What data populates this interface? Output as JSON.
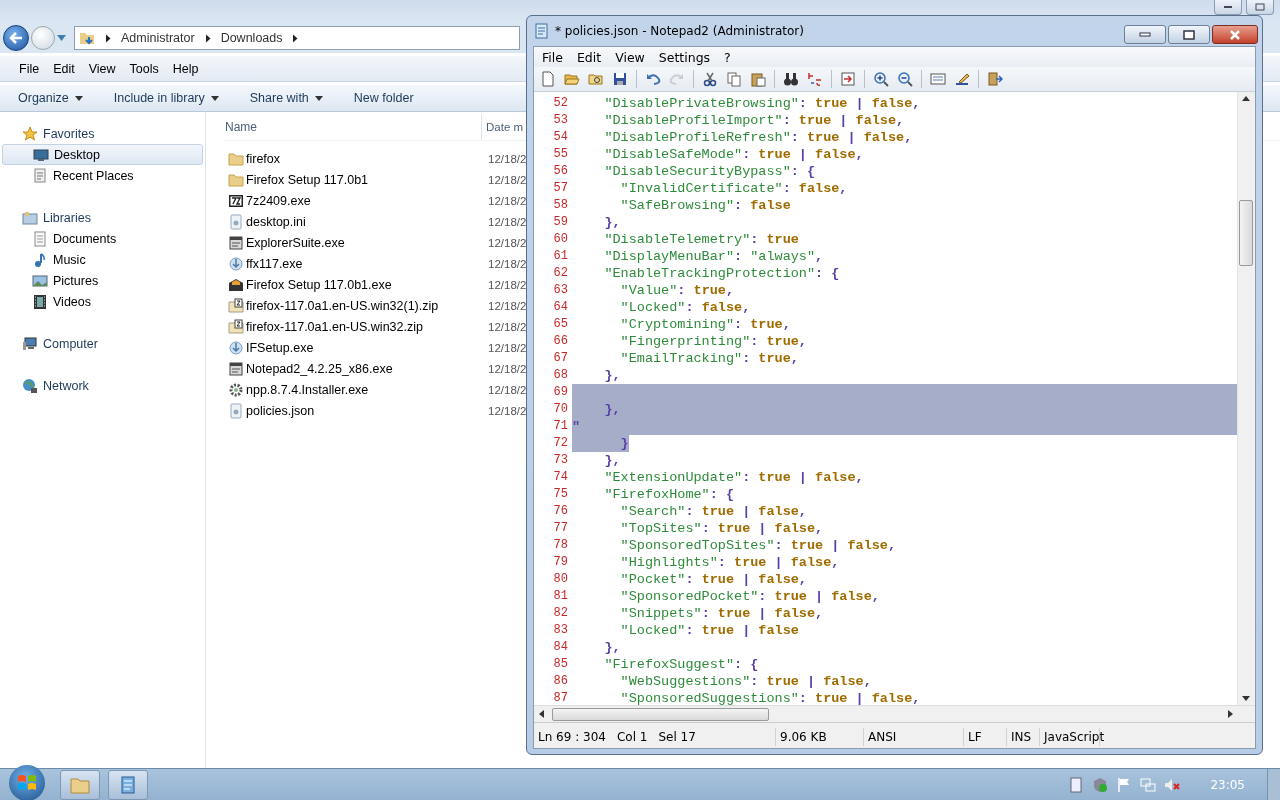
{
  "explorer": {
    "address": [
      "Administrator",
      "Downloads"
    ],
    "menu": [
      "File",
      "Edit",
      "View",
      "Tools",
      "Help"
    ],
    "commands": [
      {
        "label": "Organize",
        "dropdown": true
      },
      {
        "label": "Include in library",
        "dropdown": true
      },
      {
        "label": "Share with",
        "dropdown": true
      },
      {
        "label": "New folder",
        "dropdown": false
      }
    ],
    "nav": [
      {
        "label": "Favorites",
        "kind": "star",
        "selected": false,
        "children": [
          {
            "label": "Desktop",
            "kind": "desktop",
            "selected": true
          },
          {
            "label": "Recent Places",
            "kind": "recent",
            "selected": false
          }
        ]
      },
      {
        "label": "Libraries",
        "kind": "library",
        "selected": false,
        "children": [
          {
            "label": "Documents",
            "kind": "document",
            "selected": false
          },
          {
            "label": "Music",
            "kind": "music",
            "selected": false
          },
          {
            "label": "Pictures",
            "kind": "pictures",
            "selected": false
          },
          {
            "label": "Videos",
            "kind": "video",
            "selected": false
          }
        ]
      },
      {
        "label": "Computer",
        "kind": "computer",
        "selected": false
      },
      {
        "label": "Network",
        "kind": "network",
        "selected": false
      }
    ],
    "columns": [
      "Name",
      "Date m"
    ],
    "files": [
      {
        "name": "firefox",
        "date": "12/18/2",
        "kind": "folder"
      },
      {
        "name": "Firefox Setup 117.0b1",
        "date": "12/18/2",
        "kind": "folder"
      },
      {
        "name": "7z2409.exe",
        "date": "12/18/2",
        "kind": "sevenzip"
      },
      {
        "name": "desktop.ini",
        "date": "12/18/2",
        "kind": "settings"
      },
      {
        "name": "ExplorerSuite.exe",
        "date": "12/18/2",
        "kind": "app"
      },
      {
        "name": "ffx117.exe",
        "date": "12/18/2",
        "kind": "installer"
      },
      {
        "name": "Firefox Setup 117.0b1.exe",
        "date": "12/18/2",
        "kind": "package"
      },
      {
        "name": "firefox-117.0a1.en-US.win32(1).zip",
        "date": "12/18/2",
        "kind": "zip"
      },
      {
        "name": "firefox-117.0a1.en-US.win32.zip",
        "date": "12/18/2",
        "kind": "zip"
      },
      {
        "name": "IFSetup.exe",
        "date": "12/18/2",
        "kind": "installer"
      },
      {
        "name": "Notepad2_4.2.25_x86.exe",
        "date": "12/18/2",
        "kind": "app"
      },
      {
        "name": "npp.8.7.4.Installer.exe",
        "date": "12/18/2",
        "kind": "gear"
      },
      {
        "name": "policies.json",
        "date": "12/18/2",
        "kind": "settings"
      }
    ]
  },
  "notepad": {
    "title": "* policies.json - Notepad2 (Administrator)",
    "menu": [
      "File",
      "Edit",
      "View",
      "Settings",
      "?"
    ],
    "lines": [
      {
        "n": "52",
        "selected": false,
        "tokens": [
          {
            "kind": "key",
            "text": "    \"DisablePrivateBrowsing\""
          },
          {
            "kind": "punct",
            "text": ": "
          },
          {
            "kind": "bool",
            "text": "true"
          },
          {
            "kind": "punct",
            "text": " | "
          },
          {
            "kind": "bool",
            "text": "false"
          },
          {
            "kind": "punct",
            "text": ","
          }
        ]
      },
      {
        "n": "53",
        "selected": false,
        "tokens": [
          {
            "kind": "key",
            "text": "    \"DisableProfileImport\""
          },
          {
            "kind": "punct",
            "text": ": "
          },
          {
            "kind": "bool",
            "text": "true"
          },
          {
            "kind": "punct",
            "text": " | "
          },
          {
            "kind": "bool",
            "text": "false"
          },
          {
            "kind": "punct",
            "text": ","
          }
        ]
      },
      {
        "n": "54",
        "selected": false,
        "tokens": [
          {
            "kind": "key",
            "text": "    \"DisableProfileRefresh\""
          },
          {
            "kind": "punct",
            "text": ": "
          },
          {
            "kind": "bool",
            "text": "true"
          },
          {
            "kind": "punct",
            "text": " | "
          },
          {
            "kind": "bool",
            "text": "false"
          },
          {
            "kind": "punct",
            "text": ","
          }
        ]
      },
      {
        "n": "55",
        "selected": false,
        "tokens": [
          {
            "kind": "key",
            "text": "    \"DisableSafeMode\""
          },
          {
            "kind": "punct",
            "text": ": "
          },
          {
            "kind": "bool",
            "text": "true"
          },
          {
            "kind": "punct",
            "text": " | "
          },
          {
            "kind": "bool",
            "text": "false"
          },
          {
            "kind": "punct",
            "text": ","
          }
        ]
      },
      {
        "n": "56",
        "selected": false,
        "tokens": [
          {
            "kind": "key",
            "text": "    \"DisableSecurityBypass\""
          },
          {
            "kind": "punct",
            "text": ": {"
          }
        ]
      },
      {
        "n": "57",
        "selected": false,
        "tokens": [
          {
            "kind": "key",
            "text": "      \"InvalidCertificate\""
          },
          {
            "kind": "punct",
            "text": ": "
          },
          {
            "kind": "bool",
            "text": "false"
          },
          {
            "kind": "punct",
            "text": ","
          }
        ]
      },
      {
        "n": "58",
        "selected": false,
        "tokens": [
          {
            "kind": "key",
            "text": "      \"SafeBrowsing\""
          },
          {
            "kind": "punct",
            "text": ": "
          },
          {
            "kind": "bool",
            "text": "false"
          }
        ]
      },
      {
        "n": "59",
        "selected": false,
        "tokens": [
          {
            "kind": "punct",
            "text": "    },"
          }
        ]
      },
      {
        "n": "60",
        "selected": false,
        "tokens": [
          {
            "kind": "key",
            "text": "    \"DisableTelemetry\""
          },
          {
            "kind": "punct",
            "text": ": "
          },
          {
            "kind": "bool",
            "text": "true"
          }
        ]
      },
      {
        "n": "61",
        "selected": false,
        "tokens": [
          {
            "kind": "key",
            "text": "    \"DisplayMenuBar\""
          },
          {
            "kind": "punct",
            "text": ": "
          },
          {
            "kind": "str",
            "text": "\"always\""
          },
          {
            "kind": "punct",
            "text": ","
          }
        ]
      },
      {
        "n": "62",
        "selected": false,
        "tokens": [
          {
            "kind": "key",
            "text": "    \"EnableTrackingProtection\""
          },
          {
            "kind": "punct",
            "text": ": {"
          }
        ]
      },
      {
        "n": "63",
        "selected": false,
        "tokens": [
          {
            "kind": "key",
            "text": "      \"Value\""
          },
          {
            "kind": "punct",
            "text": ": "
          },
          {
            "kind": "bool",
            "text": "true"
          },
          {
            "kind": "punct",
            "text": ","
          }
        ]
      },
      {
        "n": "64",
        "selected": false,
        "tokens": [
          {
            "kind": "key",
            "text": "      \"Locked\""
          },
          {
            "kind": "punct",
            "text": ": "
          },
          {
            "kind": "bool",
            "text": "false"
          },
          {
            "kind": "punct",
            "text": ","
          }
        ]
      },
      {
        "n": "65",
        "selected": false,
        "tokens": [
          {
            "kind": "key",
            "text": "      \"Cryptomining\""
          },
          {
            "kind": "punct",
            "text": ": "
          },
          {
            "kind": "bool",
            "text": "true"
          },
          {
            "kind": "punct",
            "text": ","
          }
        ]
      },
      {
        "n": "66",
        "selected": false,
        "tokens": [
          {
            "kind": "key",
            "text": "      \"Fingerprinting\""
          },
          {
            "kind": "punct",
            "text": ": "
          },
          {
            "kind": "bool",
            "text": "true"
          },
          {
            "kind": "punct",
            "text": ","
          }
        ]
      },
      {
        "n": "67",
        "selected": false,
        "tokens": [
          {
            "kind": "key",
            "text": "      \"EmailTracking\""
          },
          {
            "kind": "punct",
            "text": ": "
          },
          {
            "kind": "bool",
            "text": "true"
          },
          {
            "kind": "punct",
            "text": ","
          }
        ]
      },
      {
        "n": "68",
        "selected": false,
        "tokens": [
          {
            "kind": "punct",
            "text": "    },"
          }
        ]
      },
      {
        "n": "69",
        "selected": true
      },
      {
        "n": "70",
        "selected": true,
        "tokens": [
          {
            "kind": "punct",
            "text": "    },"
          }
        ]
      },
      {
        "n": "71",
        "selected": true,
        "tokens": [
          {
            "kind": "punct",
            "text": "\""
          }
        ]
      },
      {
        "n": "72",
        "selected": true,
        "partial": true,
        "tokens": [
          {
            "kind": "punct",
            "text": "      }"
          }
        ]
      },
      {
        "n": "73",
        "selected": false,
        "tokens": [
          {
            "kind": "punct",
            "text": "    },"
          }
        ]
      },
      {
        "n": "74",
        "selected": false,
        "tokens": [
          {
            "kind": "key",
            "text": "    \"ExtensionUpdate\""
          },
          {
            "kind": "punct",
            "text": ": "
          },
          {
            "kind": "bool",
            "text": "true"
          },
          {
            "kind": "punct",
            "text": " | "
          },
          {
            "kind": "bool",
            "text": "false"
          },
          {
            "kind": "punct",
            "text": ","
          }
        ]
      },
      {
        "n": "75",
        "selected": false,
        "tokens": [
          {
            "kind": "key",
            "text": "    \"FirefoxHome\""
          },
          {
            "kind": "punct",
            "text": ": {"
          }
        ]
      },
      {
        "n": "76",
        "selected": false,
        "tokens": [
          {
            "kind": "key",
            "text": "      \"Search\""
          },
          {
            "kind": "punct",
            "text": ": "
          },
          {
            "kind": "bool",
            "text": "true"
          },
          {
            "kind": "punct",
            "text": " | "
          },
          {
            "kind": "bool",
            "text": "false"
          },
          {
            "kind": "punct",
            "text": ","
          }
        ]
      },
      {
        "n": "77",
        "selected": false,
        "tokens": [
          {
            "kind": "key",
            "text": "      \"TopSites\""
          },
          {
            "kind": "punct",
            "text": ": "
          },
          {
            "kind": "bool",
            "text": "true"
          },
          {
            "kind": "punct",
            "text": " | "
          },
          {
            "kind": "bool",
            "text": "false"
          },
          {
            "kind": "punct",
            "text": ","
          }
        ]
      },
      {
        "n": "78",
        "selected": false,
        "tokens": [
          {
            "kind": "key",
            "text": "      \"SponsoredTopSites\""
          },
          {
            "kind": "punct",
            "text": ": "
          },
          {
            "kind": "bool",
            "text": "true"
          },
          {
            "kind": "punct",
            "text": " | "
          },
          {
            "kind": "bool",
            "text": "false"
          },
          {
            "kind": "punct",
            "text": ","
          }
        ]
      },
      {
        "n": "79",
        "selected": false,
        "tokens": [
          {
            "kind": "key",
            "text": "      \"Highlights\""
          },
          {
            "kind": "punct",
            "text": ": "
          },
          {
            "kind": "bool",
            "text": "true"
          },
          {
            "kind": "punct",
            "text": " | "
          },
          {
            "kind": "bool",
            "text": "false"
          },
          {
            "kind": "punct",
            "text": ","
          }
        ]
      },
      {
        "n": "80",
        "selected": false,
        "tokens": [
          {
            "kind": "key",
            "text": "      \"Pocket\""
          },
          {
            "kind": "punct",
            "text": ": "
          },
          {
            "kind": "bool",
            "text": "true"
          },
          {
            "kind": "punct",
            "text": " | "
          },
          {
            "kind": "bool",
            "text": "false"
          },
          {
            "kind": "punct",
            "text": ","
          }
        ]
      },
      {
        "n": "81",
        "selected": false,
        "tokens": [
          {
            "kind": "key",
            "text": "      \"SponsoredPocket\""
          },
          {
            "kind": "punct",
            "text": ": "
          },
          {
            "kind": "bool",
            "text": "true"
          },
          {
            "kind": "punct",
            "text": " | "
          },
          {
            "kind": "bool",
            "text": "false"
          },
          {
            "kind": "punct",
            "text": ","
          }
        ]
      },
      {
        "n": "82",
        "selected": false,
        "tokens": [
          {
            "kind": "key",
            "text": "      \"Snippets\""
          },
          {
            "kind": "punct",
            "text": ": "
          },
          {
            "kind": "bool",
            "text": "true"
          },
          {
            "kind": "punct",
            "text": " | "
          },
          {
            "kind": "bool",
            "text": "false"
          },
          {
            "kind": "punct",
            "text": ","
          }
        ]
      },
      {
        "n": "83",
        "selected": false,
        "tokens": [
          {
            "kind": "key",
            "text": "      \"Locked\""
          },
          {
            "kind": "punct",
            "text": ": "
          },
          {
            "kind": "bool",
            "text": "true"
          },
          {
            "kind": "punct",
            "text": " | "
          },
          {
            "kind": "bool",
            "text": "false"
          }
        ]
      },
      {
        "n": "84",
        "selected": false,
        "tokens": [
          {
            "kind": "punct",
            "text": "    },"
          }
        ]
      },
      {
        "n": "85",
        "selected": false,
        "tokens": [
          {
            "kind": "key",
            "text": "    \"FirefoxSuggest\""
          },
          {
            "kind": "punct",
            "text": ": {"
          }
        ]
      },
      {
        "n": "86",
        "selected": false,
        "tokens": [
          {
            "kind": "key",
            "text": "      \"WebSuggestions\""
          },
          {
            "kind": "punct",
            "text": ": "
          },
          {
            "kind": "bool",
            "text": "true"
          },
          {
            "kind": "punct",
            "text": " | "
          },
          {
            "kind": "bool",
            "text": "false"
          },
          {
            "kind": "punct",
            "text": ","
          }
        ]
      },
      {
        "n": "87",
        "selected": false,
        "tokens": [
          {
            "kind": "key",
            "text": "      \"SponsoredSuggestions\""
          },
          {
            "kind": "punct",
            "text": ": "
          },
          {
            "kind": "bool",
            "text": "true"
          },
          {
            "kind": "punct",
            "text": " | "
          },
          {
            "kind": "bool",
            "text": "false"
          },
          {
            "kind": "punct",
            "text": ","
          }
        ]
      }
    ],
    "status_bar": [
      {
        "items": [
          "Ln 69 : 304",
          "Col 1",
          "Sel 17"
        ]
      },
      {
        "items": [
          "9.06 KB"
        ]
      },
      {
        "items": [
          "ANSI"
        ]
      },
      {
        "items": [
          "LF"
        ]
      },
      {
        "items": [
          "INS"
        ]
      },
      {
        "items": [
          "JavaScript"
        ]
      }
    ]
  },
  "taskbar": {
    "clock": "23:05"
  }
}
